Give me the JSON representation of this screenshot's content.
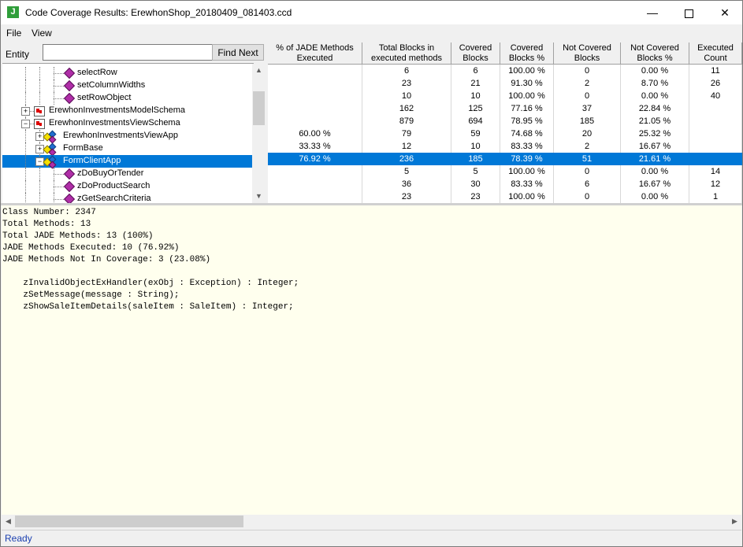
{
  "window": {
    "title": "Code Coverage Results: ErewhonShop_20180409_081403.ccd",
    "app_icon_letter": "J"
  },
  "menu": [
    {
      "label": "File",
      "accel": "F"
    },
    {
      "label": "View",
      "accel": "V"
    }
  ],
  "entity": {
    "label": "Entity",
    "value": "",
    "find_label": "Find Next"
  },
  "tree": [
    {
      "label": "selectRow",
      "type": "method"
    },
    {
      "label": "setColumnWidths",
      "type": "method"
    },
    {
      "label": "setRowObject",
      "type": "method"
    },
    {
      "label": "ErewhonInvestmentsModelSchema",
      "type": "schema",
      "expander": "+"
    },
    {
      "label": "ErewhonInvestmentsViewSchema",
      "type": "schema",
      "expander": "-"
    },
    {
      "label": "ErewhonInvestmentsViewApp",
      "type": "class",
      "expander": "+"
    },
    {
      "label": "FormBase",
      "type": "class",
      "expander": "+"
    },
    {
      "label": "FormClientApp",
      "type": "class",
      "expander": "-",
      "selected": true
    },
    {
      "label": "zDoBuyOrTender",
      "type": "method"
    },
    {
      "label": "zDoProductSearch",
      "type": "method"
    },
    {
      "label": "zGetSearchCriteria",
      "type": "method"
    }
  ],
  "grid": {
    "headers": [
      "% of JADE Methods Executed",
      "Total Blocks in executed methods",
      "Covered Blocks",
      "Covered Blocks %",
      "Not Covered Blocks",
      "Not Covered Blocks %",
      "Executed Count"
    ],
    "rows": [
      [
        "",
        "6",
        "6",
        "100.00 %",
        "0",
        "0.00 %",
        "11"
      ],
      [
        "",
        "23",
        "21",
        "91.30 %",
        "2",
        "8.70 %",
        "26"
      ],
      [
        "",
        "10",
        "10",
        "100.00 %",
        "0",
        "0.00 %",
        "40"
      ],
      [
        "",
        "162",
        "125",
        "77.16 %",
        "37",
        "22.84 %",
        ""
      ],
      [
        "",
        "879",
        "694",
        "78.95 %",
        "185",
        "21.05 %",
        ""
      ],
      [
        "60.00 %",
        "79",
        "59",
        "74.68 %",
        "20",
        "25.32 %",
        ""
      ],
      [
        "33.33 %",
        "12",
        "10",
        "83.33 %",
        "2",
        "16.67 %",
        ""
      ],
      [
        "76.92 %",
        "236",
        "185",
        "78.39 %",
        "51",
        "21.61 %",
        ""
      ],
      [
        "",
        "5",
        "5",
        "100.00 %",
        "0",
        "0.00 %",
        "14"
      ],
      [
        "",
        "36",
        "30",
        "83.33 %",
        "6",
        "16.67 %",
        "12"
      ],
      [
        "",
        "23",
        "23",
        "100.00 %",
        "0",
        "0.00 %",
        "1"
      ]
    ]
  },
  "details": {
    "text": "Class Number: 2347\nTotal Methods: 13\nTotal JADE Methods: 13 (100%)\nJADE Methods Executed: 10 (76.92%)\nJADE Methods Not In Coverage: 3 (23.08%)\n\n    zInvalidObjectExHandler(exObj : Exception) : Integer;\n    zSetMessage(message : String);\n    zShowSaleItemDetails(saleItem : SaleItem) : Integer;"
  },
  "status": {
    "text": "Ready"
  },
  "colors": {
    "selection": "#0078d7",
    "detail_background": "#ffffee",
    "status_text": "#1a3fb0"
  }
}
